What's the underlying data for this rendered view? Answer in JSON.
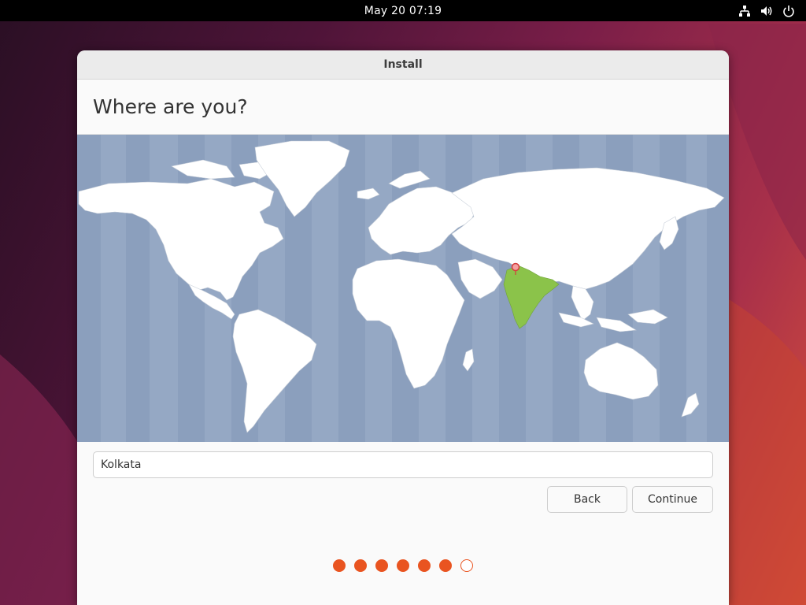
{
  "topbar": {
    "clock": "May 20  07:19",
    "icons": [
      "network-wired-icon",
      "volume-icon",
      "power-icon"
    ]
  },
  "window": {
    "title": "Install",
    "heading": "Where are you?",
    "timezone_input": {
      "value": "Kolkata",
      "placeholder": ""
    },
    "buttons": {
      "back": "Back",
      "continue": "Continue"
    },
    "progress": {
      "total_steps": 7,
      "completed_steps": 6
    }
  },
  "map": {
    "selected_region": "India",
    "selected_city": "Kolkata",
    "ocean_color": "#95a8c4",
    "land_color": "#ffffff",
    "highlight_color": "#8bc34a",
    "pin_color": "#e04848"
  },
  "colors": {
    "accent": "#e95420",
    "topbar": "#000000",
    "window_bg": "#fafafa"
  }
}
